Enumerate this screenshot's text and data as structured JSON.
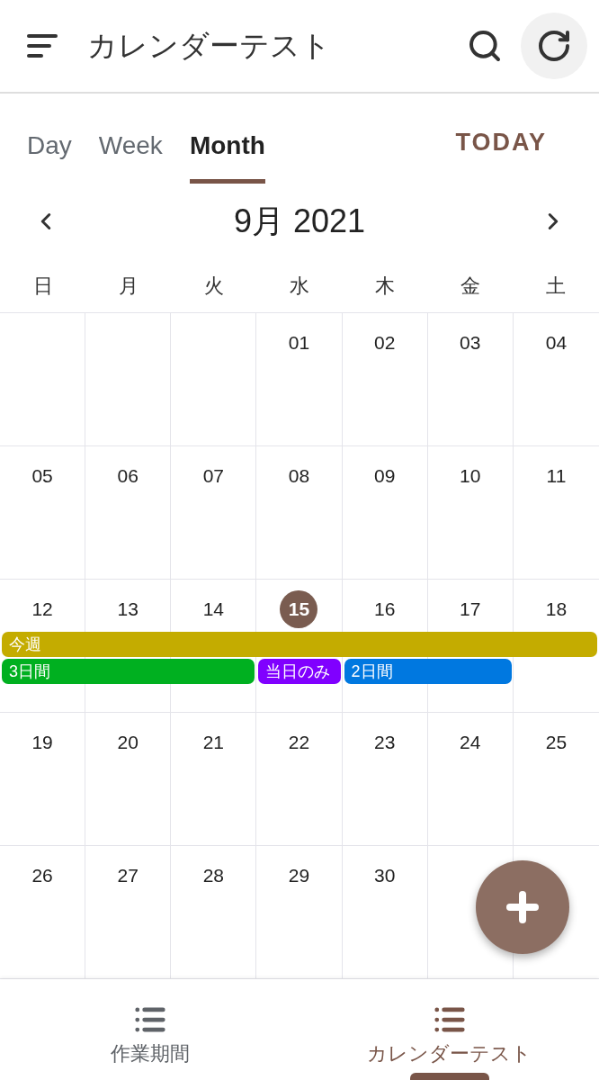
{
  "app_bar": {
    "title": "カレンダーテスト"
  },
  "view_tabs": [
    {
      "label": "Day",
      "selected": false
    },
    {
      "label": "Week",
      "selected": false
    },
    {
      "label": "Month",
      "selected": true
    }
  ],
  "today_button": "TODAY",
  "month_label": "9月 2021",
  "weekdays": [
    "日",
    "月",
    "火",
    "水",
    "木",
    "金",
    "土"
  ],
  "weeks": [
    {
      "days": [
        {
          "kind": "blank"
        },
        {
          "kind": "blank"
        },
        {
          "kind": "blank"
        },
        {
          "kind": "day",
          "label": "01",
          "today": false
        },
        {
          "kind": "day",
          "label": "02",
          "today": false
        },
        {
          "kind": "day",
          "label": "03",
          "today": false
        },
        {
          "kind": "day",
          "label": "04",
          "today": false
        }
      ]
    },
    {
      "days": [
        {
          "kind": "day",
          "label": "05",
          "today": false
        },
        {
          "kind": "day",
          "label": "06",
          "today": false
        },
        {
          "kind": "day",
          "label": "07",
          "today": false
        },
        {
          "kind": "day",
          "label": "08",
          "today": false
        },
        {
          "kind": "day",
          "label": "09",
          "today": false
        },
        {
          "kind": "day",
          "label": "10",
          "today": false
        },
        {
          "kind": "day",
          "label": "11",
          "today": false
        }
      ]
    },
    {
      "days": [
        {
          "kind": "day",
          "label": "12",
          "today": false
        },
        {
          "kind": "day",
          "label": "13",
          "today": false
        },
        {
          "kind": "day",
          "label": "14",
          "today": false
        },
        {
          "kind": "day",
          "label": "15",
          "today": true
        },
        {
          "kind": "day",
          "label": "16",
          "today": false
        },
        {
          "kind": "day",
          "label": "17",
          "today": false
        },
        {
          "kind": "day",
          "label": "18",
          "today": false
        }
      ],
      "event_lanes": [
        [
          {
            "kind": "start",
            "label": "今週",
            "color": "#c4ac00"
          },
          {
            "kind": "continue"
          },
          {
            "kind": "continue"
          },
          {
            "kind": "continue"
          },
          {
            "kind": "continue"
          },
          {
            "kind": "continue"
          },
          {
            "kind": "continue"
          }
        ],
        [
          {
            "kind": "start",
            "label": "3日間",
            "color": "#00b020"
          },
          {
            "kind": "continue"
          },
          {
            "kind": "continue"
          },
          {
            "kind": "start",
            "label": "当日のみ",
            "color": "#8000ff"
          },
          {
            "kind": "start",
            "label": "2日間",
            "color": "#0078e0"
          },
          {
            "kind": "continue"
          },
          {
            "kind": "empty"
          }
        ]
      ]
    },
    {
      "days": [
        {
          "kind": "day",
          "label": "19",
          "today": false
        },
        {
          "kind": "day",
          "label": "20",
          "today": false
        },
        {
          "kind": "day",
          "label": "21",
          "today": false
        },
        {
          "kind": "day",
          "label": "22",
          "today": false
        },
        {
          "kind": "day",
          "label": "23",
          "today": false
        },
        {
          "kind": "day",
          "label": "24",
          "today": false
        },
        {
          "kind": "day",
          "label": "25",
          "today": false
        }
      ]
    },
    {
      "days": [
        {
          "kind": "day",
          "label": "26",
          "today": false
        },
        {
          "kind": "day",
          "label": "27",
          "today": false
        },
        {
          "kind": "day",
          "label": "28",
          "today": false
        },
        {
          "kind": "day",
          "label": "29",
          "today": false
        },
        {
          "kind": "day",
          "label": "30",
          "today": false
        },
        {
          "kind": "blank"
        },
        {
          "kind": "blank"
        }
      ]
    }
  ],
  "bottom_nav": [
    {
      "label": "作業期間",
      "selected": false
    },
    {
      "label": "カレンダーテスト",
      "selected": true
    }
  ]
}
